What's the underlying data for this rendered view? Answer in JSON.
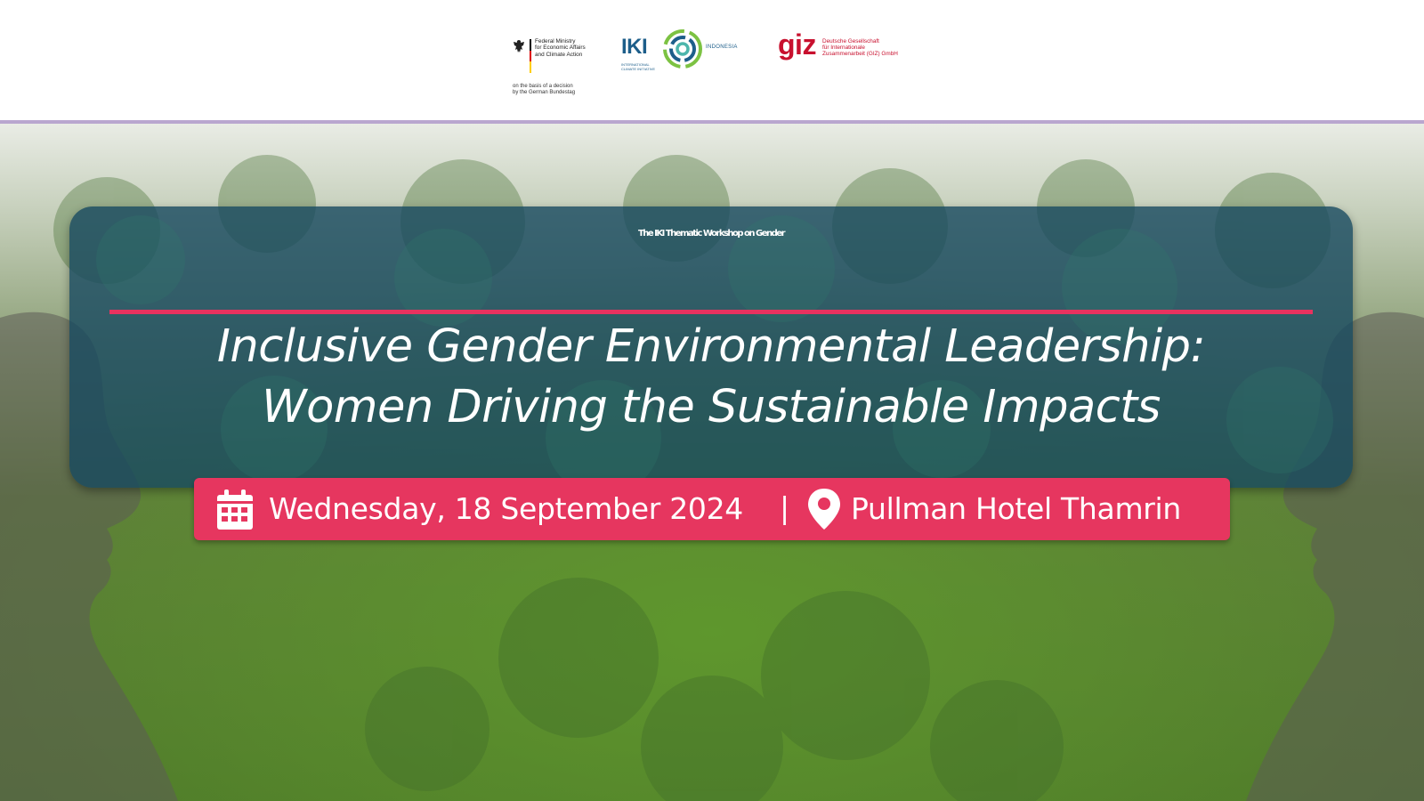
{
  "header": {
    "bmwk": {
      "lines": [
        "Federal Ministry",
        "for Economic Affairs",
        "and Climate Action"
      ],
      "sub_lines": [
        "on the basis of a decision",
        "by the German Bundestag"
      ]
    },
    "iki": {
      "word": "IKI",
      "small_lines": [
        "INTERNATIONAL",
        "CLIMATE INITIATIVE"
      ],
      "country": "INDONESIA"
    },
    "giz": {
      "word": "giz",
      "lines": [
        "Deutsche Gesellschaft",
        "für Internationale",
        "Zusammenarbeit (GIZ) GmbH"
      ]
    }
  },
  "event": {
    "title": "The IKI Thematic Workshop on Gender",
    "subtitle_lines": [
      "Inclusive Gender Environmental Leadership:",
      "Women Driving the Sustainable Impacts"
    ],
    "date": "Wednesday, 18 September 2024",
    "separator": "|",
    "venue": "Pullman Hotel Thamrin"
  },
  "colors": {
    "accent": "#e6365f",
    "panel": "#16485f",
    "iki_blue": "#1d5e8a",
    "giz_red": "#c8102e"
  },
  "icons": [
    "calendar-icon",
    "location-pin-icon",
    "federal-eagle-icon",
    "iki-circle-logo-icon"
  ]
}
